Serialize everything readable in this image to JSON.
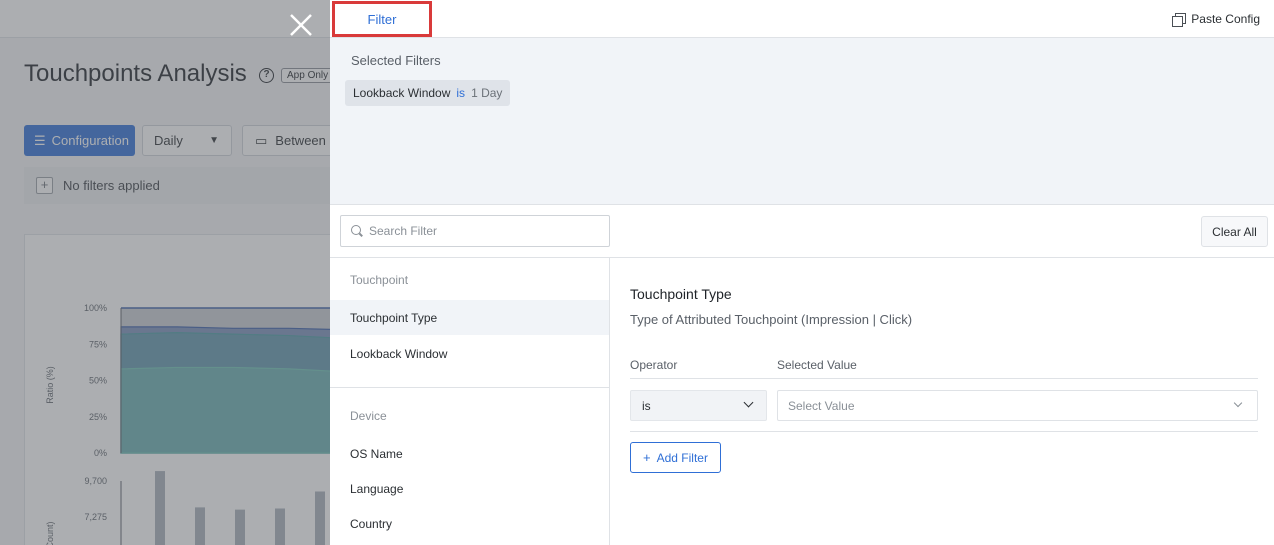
{
  "background": {
    "page_title": "Touchpoints Analysis",
    "help_icon": "?",
    "badge": "App Only",
    "configuration_label": "Configuration",
    "granularity_value": "Daily",
    "between_label": "Between",
    "filters_status": "No filters applied",
    "chart": {
      "ylabel_top": "Ratio (%)",
      "ylabel_bottom": "Count)",
      "top_ticks": [
        "100%",
        "75%",
        "50%",
        "25%",
        "0%"
      ],
      "bottom_ticks": [
        "9,700",
        "7,275"
      ]
    },
    "chart_data": [
      {
        "type": "area",
        "ylabel": "Ratio (%)",
        "yticks": [
          "100%",
          "75%",
          "50%",
          "25%",
          "0%"
        ],
        "ylim": [
          0,
          100
        ],
        "series": [
          {
            "color": "#3b5fa8",
            "values": [
              87,
              87,
              86,
              86,
              85
            ]
          },
          {
            "color": "#4a9aa3",
            "values": [
              82,
              83,
              82,
              81,
              79
            ]
          },
          {
            "color": "#6fc2b5",
            "values": [
              58,
              59,
              59,
              58,
              56
            ]
          }
        ]
      },
      {
        "type": "bar",
        "ylabel": "Count)",
        "yticks": [
          "9,700",
          "7,275"
        ],
        "values": [
          7400,
          4200,
          4000,
          4100,
          5600
        ]
      }
    ]
  },
  "drawer": {
    "tab_label": "Filter",
    "paste_config_label": "Paste Config",
    "selected_filters_title": "Selected Filters",
    "selected_chip": {
      "field": "Lookback Window",
      "operator": "is",
      "value": "1 Day"
    },
    "search_placeholder": "Search Filter",
    "clear_all_label": "Clear All",
    "groups": [
      {
        "label": "Touchpoint",
        "items": [
          "Touchpoint Type",
          "Lookback Window"
        ]
      },
      {
        "label": "Device",
        "items": [
          "OS Name",
          "Language",
          "Country"
        ]
      }
    ],
    "active_item": "Touchpoint Type",
    "detail": {
      "title": "Touchpoint Type",
      "description": "Type of Attributed Touchpoint (Impression | Click)",
      "operator_header": "Operator",
      "value_header": "Selected Value",
      "operator_value": "is",
      "value_placeholder": "Select Value",
      "add_filter_label": "Add Filter"
    }
  },
  "colors": {
    "accent": "#2f6fd6",
    "highlight_border": "#d93a3a",
    "selected_bg": "#f1f4f8"
  },
  "icons": [
    "close-icon",
    "help-icon",
    "paste-config-icon",
    "search-icon",
    "chevron-down-icon",
    "plus-icon"
  ]
}
